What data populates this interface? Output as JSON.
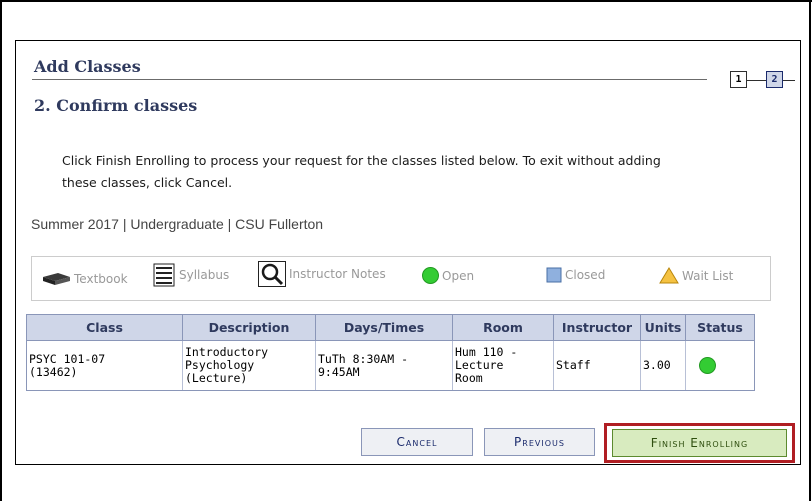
{
  "header": {
    "title": "Add Classes",
    "steps": [
      "1",
      "2"
    ],
    "subtitle": "2.  Confirm classes"
  },
  "instructions": "Click Finish Enrolling to process your request for the classes listed below. To exit without adding these classes, click Cancel.",
  "term_line": "Summer 2017 | Undergraduate | CSU Fullerton",
  "legend": {
    "textbook": "Textbook",
    "syllabus": "Syllabus",
    "instructor_notes": "Instructor Notes",
    "open": "Open",
    "closed": "Closed",
    "wait_list": "Wait List"
  },
  "table": {
    "headers": [
      "Class",
      "Description",
      "Days/Times",
      "Room",
      "Instructor",
      "Units",
      "Status"
    ],
    "rows": [
      {
        "class": "PSYC 101-07\n(13462)",
        "description": "Introductory\nPsychology\n(Lecture)",
        "days_times": "TuTh 8:30AM -\n9:45AM",
        "room": "Hum 110 -\nLecture\nRoom",
        "instructor": "Staff",
        "units": "3.00",
        "status": "Open"
      }
    ]
  },
  "buttons": {
    "cancel": "Cancel",
    "previous": "Previous",
    "finish": "Finish Enrolling"
  },
  "colors": {
    "heading": "#2f3a5e",
    "table_header_bg": "#cfd6e8",
    "open_status": "#33cc33",
    "finish_bg": "#d8ebbf",
    "highlight_border": "#b01e23"
  }
}
